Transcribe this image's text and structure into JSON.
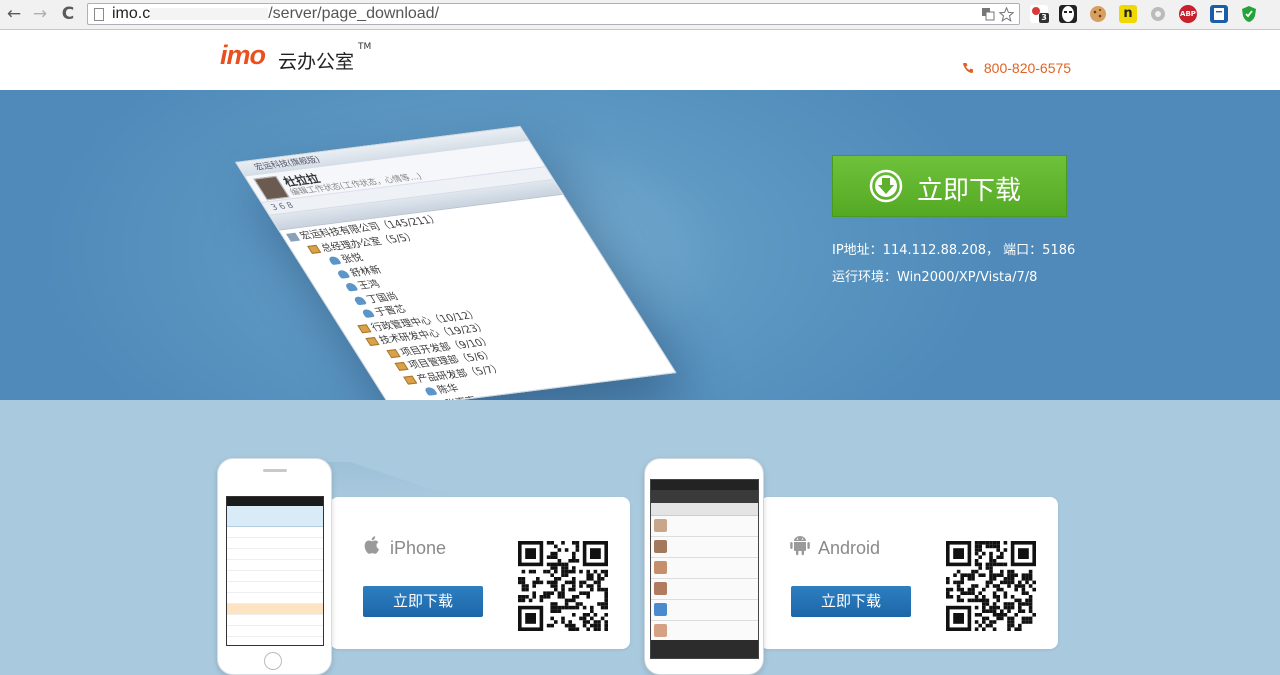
{
  "browser": {
    "url_host": "imo.c",
    "url_path": "/server/page_download/",
    "nav": {
      "back": "←",
      "forward": "→",
      "reload": "C"
    },
    "ext_badge": "3",
    "ext_abp": "ABP"
  },
  "header": {
    "logo_en": "imo",
    "logo_cn": "云办公室",
    "logo_tm": "TM",
    "phone": "800-820-6575"
  },
  "hero": {
    "download_label": "立即下载",
    "ip_text": "IP地址：114.112.88.208， 端口：5186",
    "env_text": "运行环境：Win2000/XP/Vista/7/8",
    "screen": {
      "title": "宏运科技(旗舰版)",
      "user": "杜拉拉",
      "status": "编辑工作状态(工作状态，心情等…)",
      "toolbar": "3   6   8",
      "tree": [
        {
          "label": "宏运科技有限公司（145/211）",
          "kind": "org",
          "indent": 0
        },
        {
          "label": "总经理办公室（5/5）",
          "kind": "folder",
          "indent": 1
        },
        {
          "label": "张悦",
          "kind": "person",
          "indent": 2
        },
        {
          "label": "舒林新",
          "kind": "person",
          "indent": 2
        },
        {
          "label": "王鸿",
          "kind": "person",
          "indent": 2
        },
        {
          "label": "丁国尚",
          "kind": "person",
          "indent": 2
        },
        {
          "label": "于晋芯",
          "kind": "person",
          "indent": 2
        },
        {
          "label": "行政管理中心（10/12）",
          "kind": "folder",
          "indent": 1
        },
        {
          "label": "技术研发中心（19/23）",
          "kind": "folder",
          "indent": 1
        },
        {
          "label": "项目开发部（9/10）",
          "kind": "folder",
          "indent": 2
        },
        {
          "label": "项目管理部（5/6）",
          "kind": "folder",
          "indent": 2
        },
        {
          "label": "产品研发部（5/7）",
          "kind": "folder",
          "indent": 2
        },
        {
          "label": "陈华",
          "kind": "person",
          "indent": 3
        },
        {
          "label": "张嘉声",
          "kind": "person",
          "indent": 3
        }
      ]
    }
  },
  "downloads": {
    "iphone": {
      "platform": "iPhone",
      "button": "立即下载"
    },
    "android": {
      "platform": "Android",
      "button": "立即下载"
    }
  },
  "colors": {
    "brand_orange": "#e8511f",
    "brand_blue": "#1e6fb5",
    "hero_blue": "#5e99c3",
    "download_green": "#5cb02a",
    "button_blue": "#2573b5",
    "lower_bg": "#a9c9de"
  }
}
